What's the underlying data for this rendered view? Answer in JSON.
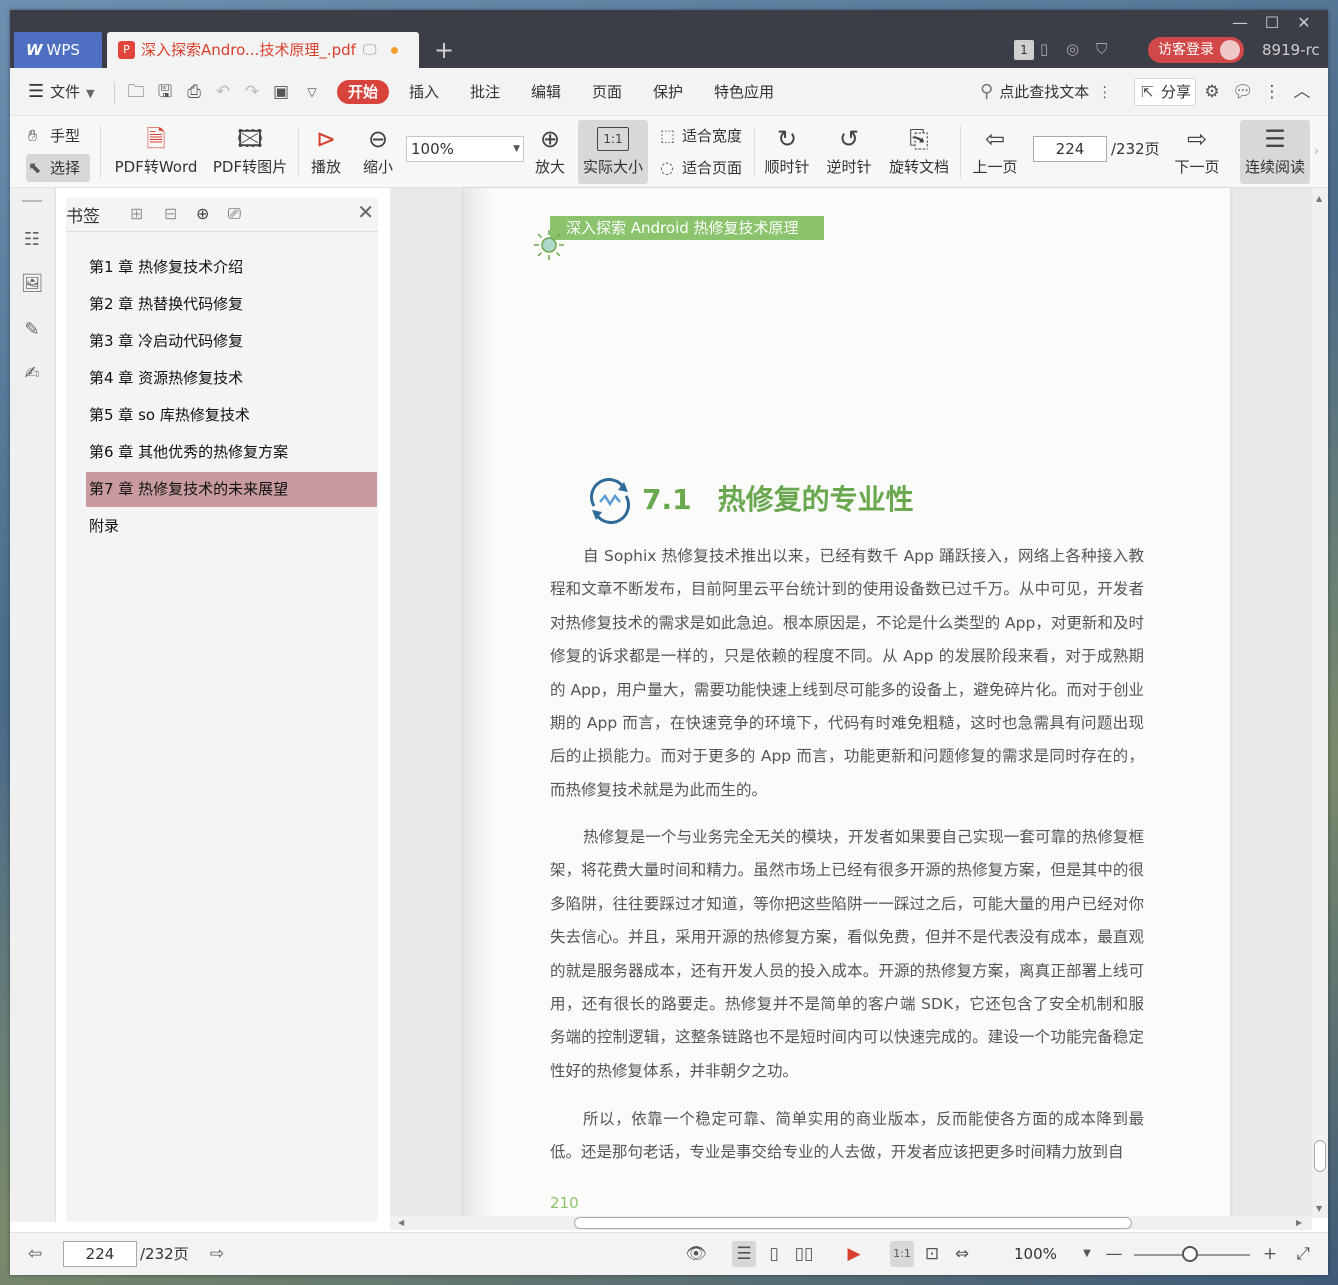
{
  "titlebar": {
    "app_tab": "WPS",
    "doc_tab": "深入探索Andro...技术原理_.pdf",
    "badge": "1",
    "login": "访客登录",
    "user": "8919-rc",
    "add_tab": "+"
  },
  "menubar": {
    "file": "文件",
    "items": [
      "开始",
      "插入",
      "批注",
      "编辑",
      "页面",
      "保护",
      "特色应用"
    ],
    "search": "点此查找文本",
    "share": "分享"
  },
  "toolbar": {
    "hand": "手型",
    "select": "选择",
    "pdf_to_word": "PDF转Word",
    "pdf_to_image": "PDF转图片",
    "play": "播放",
    "zoom_out": "缩小",
    "zoom_value": "100%",
    "zoom_in": "放大",
    "actual_size": "实际大小",
    "actual_size_icon_text": "1:1",
    "fit_width": "适合宽度",
    "fit_page": "适合页面",
    "clockwise": "顺时针",
    "counterclockwise": "逆时针",
    "rotate_doc": "旋转文档",
    "prev_page": "上一页",
    "page_current": "224",
    "page_total": "/232页",
    "next_page": "下一页",
    "continuous": "连续阅读"
  },
  "bookmarks": {
    "title": "书签",
    "items": [
      "第1 章 热修复技术介绍",
      "第2 章 热替换代码修复",
      "第3 章 冷启动代码修复",
      "第4 章 资源热修复技术",
      "第5 章 so 库热修复技术",
      "第6 章 其他优秀的热修复方案",
      "第7 章 热修复技术的未来展望",
      "附录"
    ],
    "selected_index": 6
  },
  "page": {
    "header": "深入探索 Android 热修复技术原理",
    "section_number": "7.1",
    "section_title": "热修复的专业性",
    "paragraphs": [
      "自 Sophix 热修复技术推出以来，已经有数千 App 踊跃接入，网络上各种接入教程和文章不断发布，目前阿里云平台统计到的使用设备数已过千万。从中可见，开发者对热修复技术的需求是如此急迫。根本原因是，不论是什么类型的 App，对更新和及时修复的诉求都是一样的，只是依赖的程度不同。从 App 的发展阶段来看，对于成熟期的 App，用户量大，需要功能快速上线到尽可能多的设备上，避免碎片化。而对于创业期的 App 而言，在快速竞争的环境下，代码有时难免粗糙，这时也急需具有问题出现后的止损能力。而对于更多的 App 而言，功能更新和问题修复的需求是同时存在的，而热修复技术就是为此而生的。",
      "热修复是一个与业务完全无关的模块，开发者如果要自己实现一套可靠的热修复框架，将花费大量时间和精力。虽然市场上已经有很多开源的热修复方案，但是其中的很多陷阱，往往要踩过才知道，等你把这些陷阱一一踩过之后，可能大量的用户已经对你失去信心。并且，采用开源的热修复方案，看似免费，但并不是代表没有成本，最直观的就是服务器成本，还有开发人员的投入成本。开源的热修复方案，离真正部署上线可用，还有很长的路要走。热修复并不是简单的客户端 SDK，它还包含了安全机制和服务端的控制逻辑，这整条链路也不是短时间内可以快速完成的。建设一个功能完备稳定性好的热修复体系，并非朝夕之功。",
      "所以，依靠一个稳定可靠、简单实用的商业版本，反而能使各方面的成本降到最低。还是那句老话，专业是事交给专业的人去做，开发者应该把更多时间精力放到自"
    ],
    "page_number": "210"
  },
  "statusbar": {
    "page_current": "224",
    "page_total": "/232页",
    "zoom": "100%",
    "actual_size_icon_text": "1:1"
  },
  "colors": {
    "accent_red": "#d8433c",
    "bookmark_selected": "#c99ba0",
    "section_green": "#6aa84f",
    "banner_green": "#8cc46e"
  },
  "icons": {
    "hand": "hand-icon",
    "select": "cursor-icon",
    "search": "search-icon",
    "settings": "gear-icon"
  }
}
